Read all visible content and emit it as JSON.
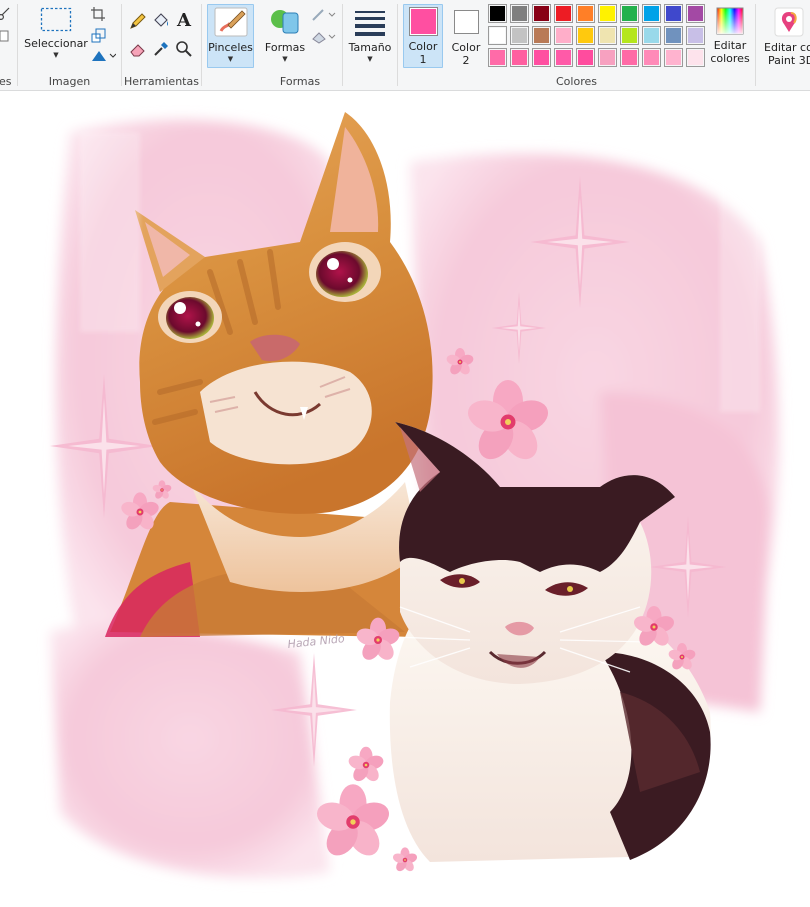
{
  "ribbon": {
    "partial_group_label": "es",
    "imagen": {
      "label": "Imagen",
      "select_button": "Seleccionar"
    },
    "herramientas": {
      "label": "Herramientas",
      "text_tool_glyph": "A"
    },
    "pinceles": {
      "label": "Pinceles"
    },
    "formas": {
      "label": "Formas",
      "shapes_button": "Formas"
    },
    "tamano": {
      "label": "Tamaño"
    },
    "colores": {
      "label": "Colores",
      "color1_line1": "Color",
      "color1_line2": "1",
      "color2_line1": "Color",
      "color2_line2": "2",
      "edit_colors_line1": "Editar",
      "edit_colors_line2": "colores",
      "color1_value": "#ff4fa1",
      "color2_value": "#ffffff",
      "palette_row1": [
        "#000000",
        "#7f7f7f",
        "#880015",
        "#ed1c24",
        "#ff7f27",
        "#fff200",
        "#22b14c",
        "#00a2e8",
        "#3f48cc",
        "#a349a4"
      ],
      "palette_row2": [
        "#ffffff",
        "#c3c3c3",
        "#b97a57",
        "#ffaec9",
        "#ffc90e",
        "#efe4b0",
        "#b5e61d",
        "#99d9ea",
        "#7092be",
        "#c8bfe7"
      ],
      "palette_row3": [
        "#ff6ba8",
        "#ff5fa0",
        "#ff4fa1",
        "#ff5aa8",
        "#ff4c9e",
        "#f7a1c0",
        "#ff6aa6",
        "#ff8ab8",
        "#ffb3cf",
        "#fde3ec"
      ]
    },
    "paint3d": {
      "line1": "Editar con",
      "line2": "Paint 3D"
    }
  },
  "canvas": {
    "artist_signature": "Hada Nido"
  }
}
